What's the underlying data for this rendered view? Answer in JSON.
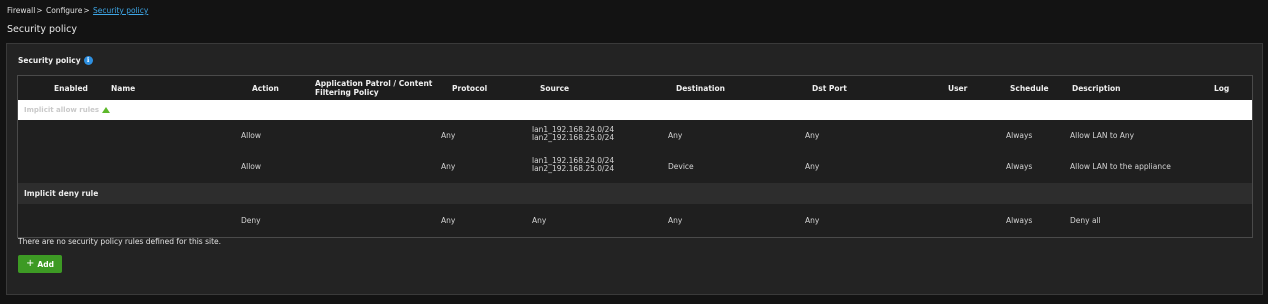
{
  "breadcrumb": {
    "items": [
      "Firewall",
      "Configure"
    ],
    "current": "Security policy",
    "separator": ">"
  },
  "page_title": "Security policy",
  "section": {
    "title": "Security policy",
    "info_icon": "info-icon"
  },
  "table": {
    "headers": {
      "enabled": "Enabled",
      "name": "Name",
      "action": "Action",
      "app_patrol": "Application Patrol / Content Filtering Policy",
      "protocol": "Protocol",
      "source": "Source",
      "destination": "Destination",
      "dst_port": "Dst Port",
      "user": "User",
      "schedule": "Schedule",
      "description": "Description",
      "log": "Log"
    },
    "allow_group_label": "Implicit allow rules",
    "deny_group_label": "Implicit deny rule",
    "rows": [
      {
        "action": "Allow",
        "protocol": "Any",
        "source_1": "lan1_192.168.24.0/24",
        "source_2": "lan2_192.168.25.0/24",
        "destination": "Any",
        "dst_port": "Any",
        "schedule": "Always",
        "description": "Allow LAN to Any"
      },
      {
        "action": "Allow",
        "protocol": "Any",
        "source_1": "lan1_192.168.24.0/24",
        "source_2": "lan2_192.168.25.0/24",
        "destination": "Device",
        "dst_port": "Any",
        "schedule": "Always",
        "description": "Allow LAN to the appliance"
      },
      {
        "action": "Deny",
        "protocol": "Any",
        "source": "Any",
        "destination": "Any",
        "dst_port": "Any",
        "schedule": "Always",
        "description": "Deny all"
      }
    ]
  },
  "empty_message": "There are no security policy rules defined for this site.",
  "add_button": {
    "label": "Add",
    "icon": "plus-icon"
  },
  "colors": {
    "accent_link": "#3ea6e6",
    "add_button": "#3d9a24",
    "info_icon": "#2d8fe0",
    "expand_triangle": "#5cb82a"
  }
}
